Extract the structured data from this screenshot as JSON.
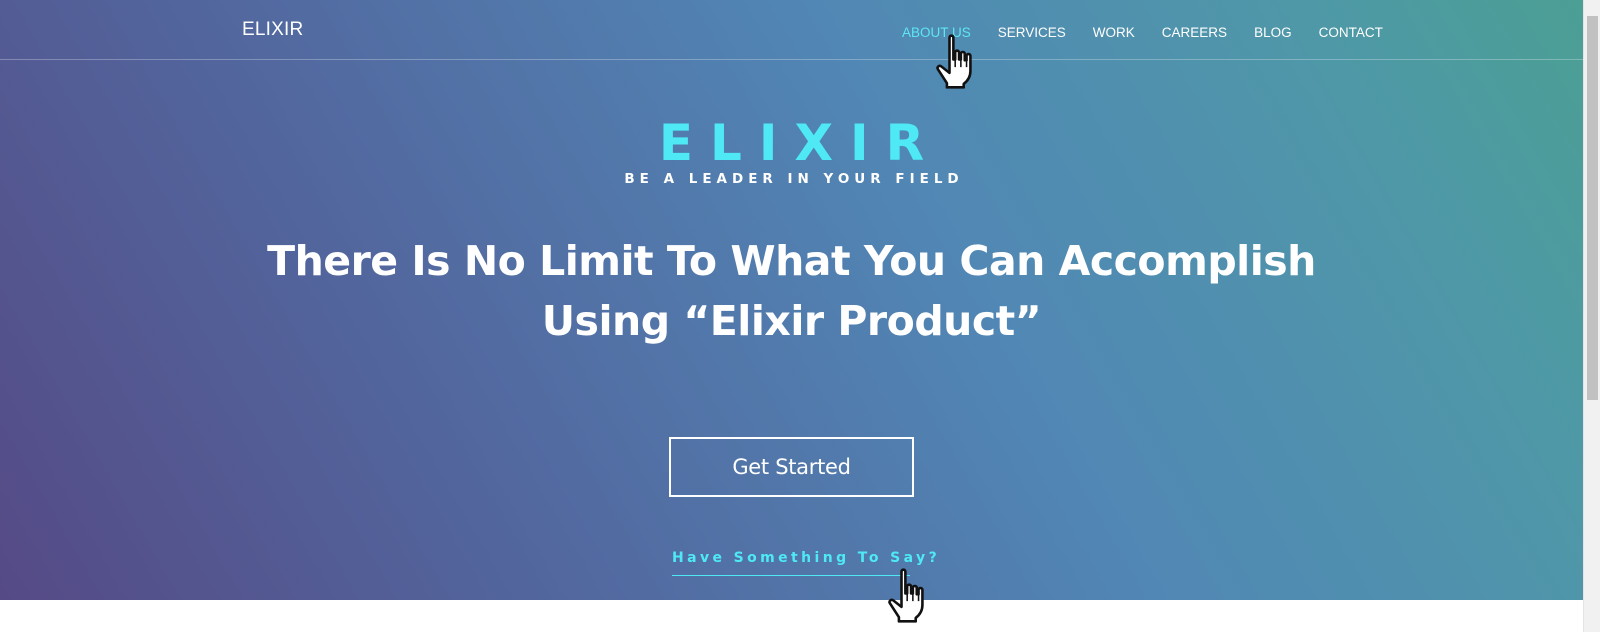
{
  "nav": {
    "brand": "ELIXIR",
    "items": [
      {
        "label": "ABOUT US",
        "active": true
      },
      {
        "label": "SERVICES",
        "active": false
      },
      {
        "label": "WORK",
        "active": false
      },
      {
        "label": "CAREERS",
        "active": false
      },
      {
        "label": "BLOG",
        "active": false
      },
      {
        "label": "CONTACT",
        "active": false
      }
    ]
  },
  "hero": {
    "logo_title": "ELIXIR",
    "tagline": "BE A LEADER IN YOUR FIELD",
    "headline_line1": "There Is No Limit To What You Can Accomplish",
    "headline_line2": "Using “Elixir Product”",
    "cta_label": "Get Started",
    "contact_link": "Have Something To Say?"
  },
  "colors": {
    "accent": "#4ee9f5",
    "gradient_start": "#554a86",
    "gradient_mid": "#5187b5",
    "gradient_end": "#4b9f94"
  },
  "icons": {
    "cursor": "hand-pointer-icon"
  }
}
